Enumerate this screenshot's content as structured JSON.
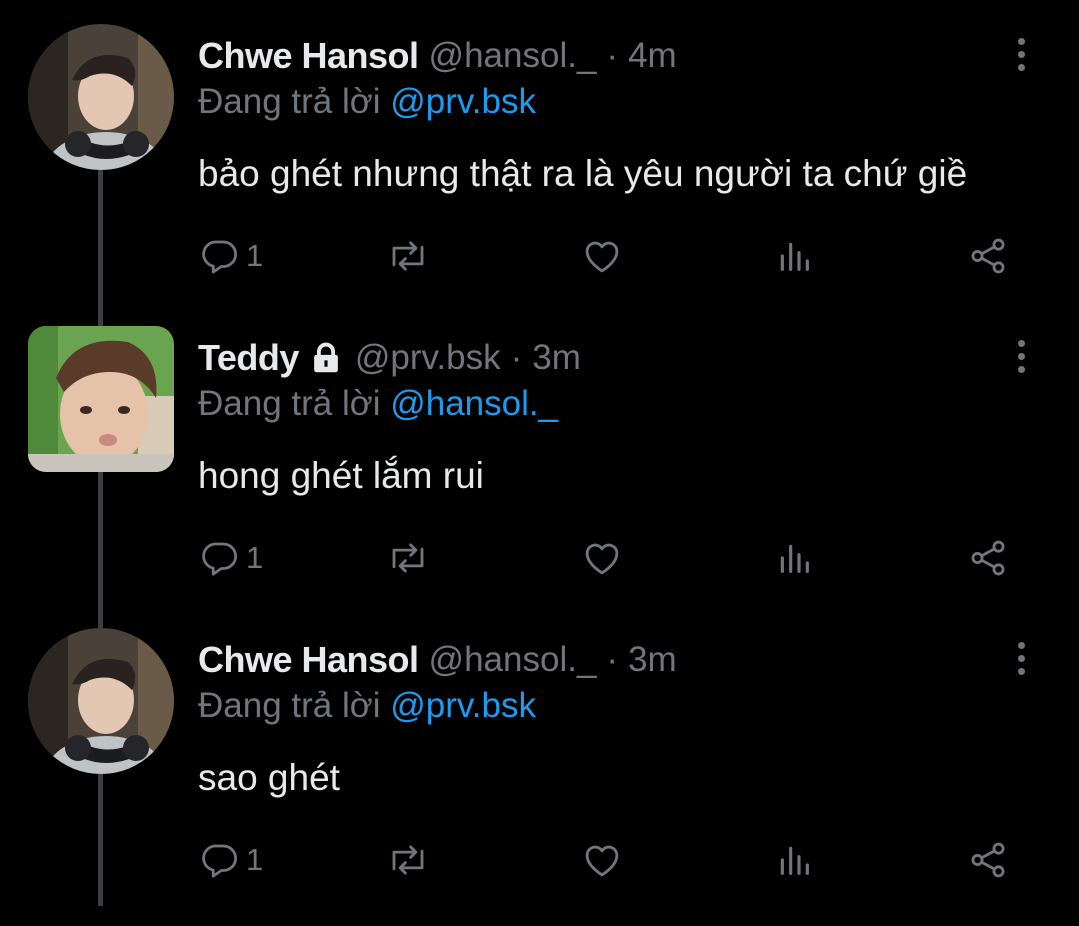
{
  "colors": {
    "background": "#000000",
    "text_primary": "#e7e9ea",
    "text_secondary": "#71767b",
    "link": "#1d9bf0",
    "thread_line": "#3a3f44"
  },
  "tweets": [
    {
      "name": "Chwe Hansol",
      "handle": "@hansol._",
      "separator": "·",
      "time": "4m",
      "protected": false,
      "reply_prefix": "Đang trả lời ",
      "reply_to": "@prv.bsk",
      "text": "bảo ghét nhưng thật ra là yêu người ta chứ giề",
      "reply_count": "1",
      "avatar_icon": "user-photo-hansol"
    },
    {
      "name": "Teddy",
      "handle": "@prv.bsk",
      "separator": "·",
      "time": "3m",
      "protected": true,
      "reply_prefix": "Đang trả lời ",
      "reply_to": "@hansol._",
      "text": "hong ghét lắm rui",
      "reply_count": "1",
      "avatar_icon": "user-photo-teddy"
    },
    {
      "name": "Chwe Hansol",
      "handle": "@hansol._",
      "separator": "·",
      "time": "3m",
      "protected": false,
      "reply_prefix": "Đang trả lời ",
      "reply_to": "@prv.bsk",
      "text": "sao ghét",
      "reply_count": "1",
      "avatar_icon": "user-photo-hansol"
    }
  ],
  "action_icons": [
    "reply-icon",
    "retweet-icon",
    "like-icon",
    "views-icon",
    "share-icon"
  ]
}
